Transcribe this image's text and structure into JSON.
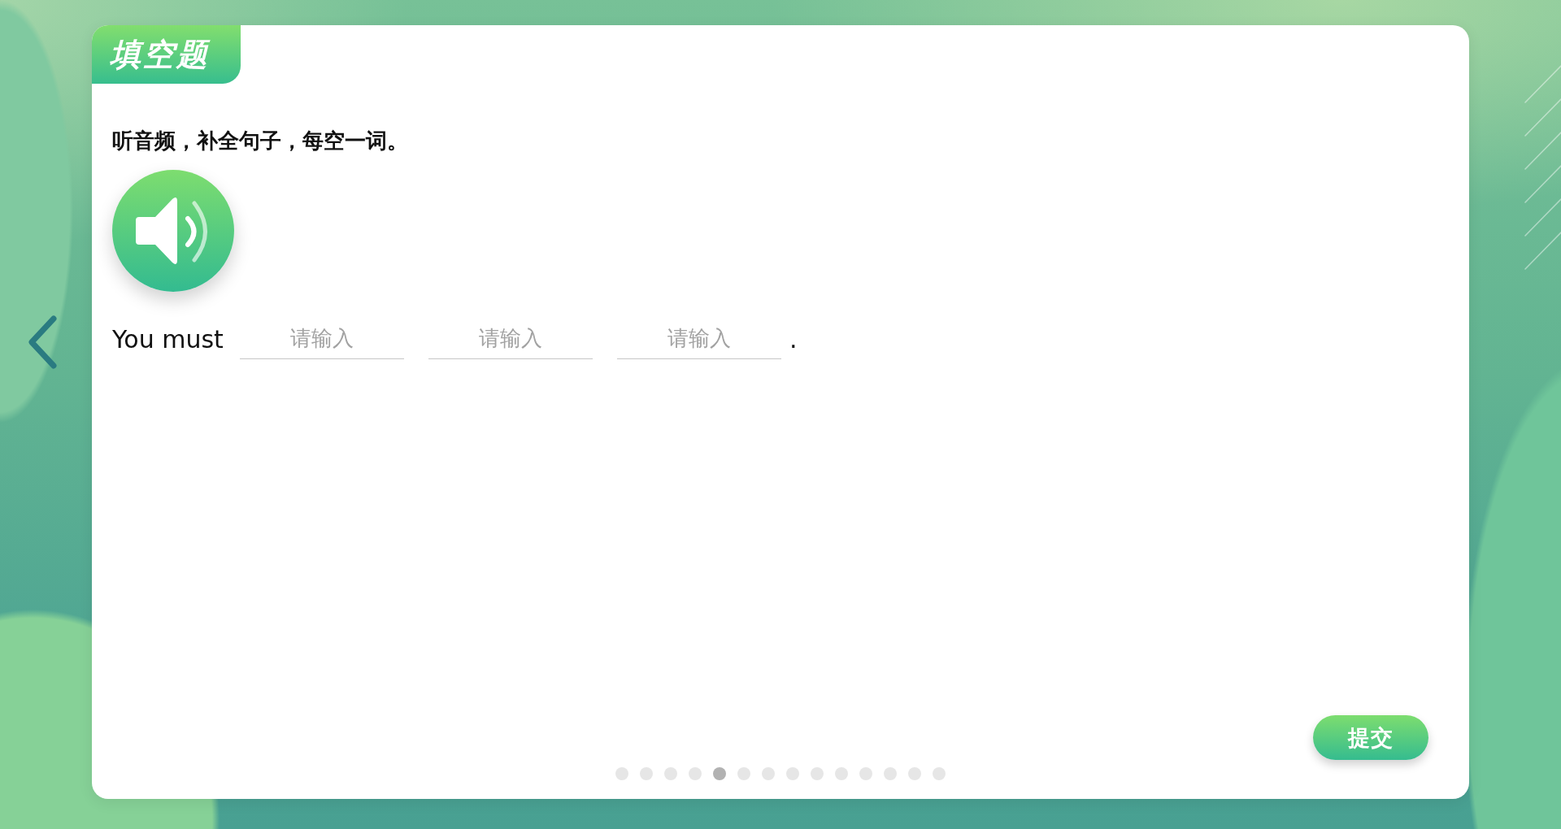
{
  "question_type": "填空题",
  "instruction": "听音频，补全句子，每空一词。",
  "sentence": [
    {
      "kind": "text",
      "text": "You must"
    },
    {
      "kind": "blank",
      "placeholder": "请输入"
    },
    {
      "kind": "blank",
      "placeholder": "请输入"
    },
    {
      "kind": "blank",
      "placeholder": "请输入"
    },
    {
      "kind": "text",
      "text": "."
    }
  ],
  "submit_button": {
    "label": "提交"
  },
  "pagination": [
    {
      "selected": false
    },
    {
      "selected": false
    },
    {
      "selected": false
    },
    {
      "selected": false
    },
    {
      "selected": true
    },
    {
      "selected": false
    },
    {
      "selected": false
    },
    {
      "selected": false
    },
    {
      "selected": false
    },
    {
      "selected": false
    },
    {
      "selected": false
    },
    {
      "selected": false
    },
    {
      "selected": false
    },
    {
      "selected": false
    }
  ]
}
